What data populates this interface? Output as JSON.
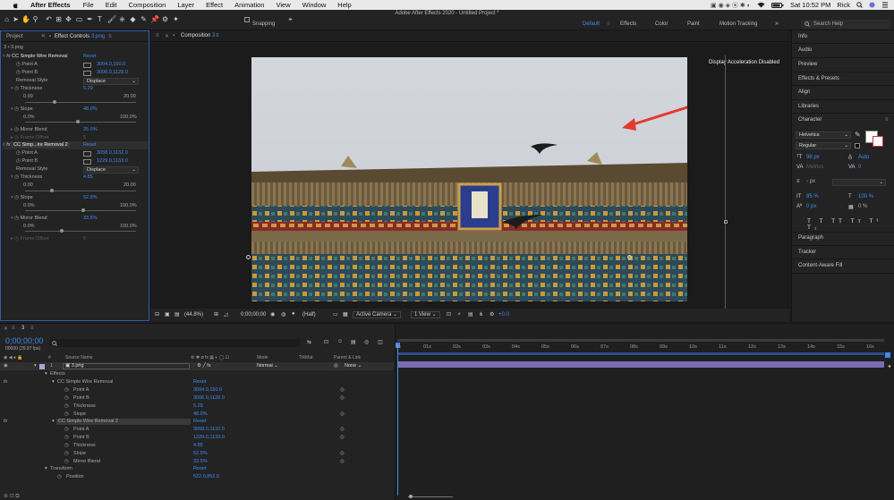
{
  "menubar": {
    "app_name": "After Effects",
    "items": [
      "File",
      "Edit",
      "Composition",
      "Layer",
      "Effect",
      "Animation",
      "View",
      "Window",
      "Help"
    ],
    "clock": "Sat 10:52 PM",
    "user": "Rick"
  },
  "toolbar": {
    "app_title": "Adobe After Effects 2020 - Untitled Project *",
    "snapping_label": "Snapping",
    "workspaces": [
      "Default",
      "Effects",
      "Color",
      "Paint",
      "Motion Tracking"
    ],
    "search_placeholder": "Search Help",
    "accent": "#3e8cf0"
  },
  "left_panel": {
    "tab_project": "Project",
    "tab_effect_controls": "Effect Controls",
    "tab_effect_controls_file": "3.png",
    "breadcrumb": "3 • 3.png",
    "fx1": {
      "name": "CC Simple Wire Removal",
      "reset": "Reset",
      "point_a_label": "Point A",
      "point_a": "3004.0,150.0",
      "point_b_label": "Point B",
      "point_b": "3006.0,1128.0",
      "removal_style_label": "Removal Style",
      "removal_style": "Displace",
      "thickness_label": "Thickness",
      "thickness": "5.29",
      "thickness_min": "0.00",
      "thickness_max": "20.00",
      "slope_label": "Slope",
      "slope": "48.0%",
      "slope_min": "0.0%",
      "slope_max": "100.0%",
      "mirror_blend_label": "Mirror Blend",
      "mirror_blend": "25.0%",
      "frame_offset_label": "Frame Offset",
      "frame_offset": "5"
    },
    "fx2": {
      "name": "CC Simp...ire Removal 2",
      "reset": "Reset",
      "point_a_label": "Point A",
      "point_a": "3058.0,1132.0",
      "point_b_label": "Point B",
      "point_b": "1229.0,1133.0",
      "removal_style_label": "Removal Style",
      "removal_style": "Displace",
      "thickness_label": "Thickness",
      "thickness": "4.85",
      "thickness_min": "0.00",
      "thickness_max": "20.00",
      "slope_label": "Slope",
      "slope": "52.9%",
      "slope_min": "0.0%",
      "slope_max": "100.0%",
      "mirror_blend_label": "Mirror Blend",
      "mirror_blend": "33.5%",
      "mirror_min": "0.0%",
      "mirror_max": "100.0%",
      "frame_offset_label": "Frame Offset",
      "frame_offset": "5"
    }
  },
  "composition": {
    "tab_label": "Composition",
    "tab_name": "3",
    "breadcrumb": "3",
    "overlay_text": "Display Acceleration Disabled",
    "controls": {
      "zoom": "(44.8%)",
      "timecode": "0;00;00;00",
      "resolution": "(Half)",
      "camera": "Active Camera",
      "views": "1 View",
      "exposure": "+0.0"
    }
  },
  "right_panel": {
    "items_top": [
      "Info",
      "Audio",
      "Preview",
      "Effects & Presets",
      "Align",
      "Libraries"
    ],
    "character_title": "Character",
    "font_family": "Helvetica",
    "font_style": "Regular",
    "font_size": "96 px",
    "leading": "Auto",
    "kerning_label": "Metrics",
    "tracking": "0",
    "stroke_width": "- px",
    "vert_scale": "85 %",
    "horiz_scale": "100 %",
    "baseline": "0 px",
    "tsume": "0 %",
    "items_bottom": [
      "Paragraph",
      "Tracker",
      "Content-Aware Fill"
    ]
  },
  "timeline": {
    "tab_label": "3",
    "timecode": "0;00;00;00",
    "fps": "00000 (29.97 fps)",
    "columns": {
      "source_name": "Source Name",
      "mode": "Mode",
      "trkmat": "TrkMat",
      "parent": "Parent & Link"
    },
    "layer": {
      "number": "1",
      "name": "3.png",
      "mode": "Normal",
      "parent": "None"
    },
    "effects_label": "Effects",
    "fx1": {
      "name": "CC Simple Wire Removal",
      "reset": "Reset",
      "props": [
        {
          "label": "Point A",
          "value": "3004.0,150.0"
        },
        {
          "label": "Point B",
          "value": "3006.0,1128.0"
        },
        {
          "label": "Thickness",
          "value": "5.29"
        },
        {
          "label": "Slope",
          "value": "48.0%"
        }
      ]
    },
    "fx2": {
      "name": "CC Simple Wire Removal 2",
      "reset": "Reset",
      "props": [
        {
          "label": "Point A",
          "value": "3058.0,1132.0"
        },
        {
          "label": "Point B",
          "value": "1229.0,1133.0"
        },
        {
          "label": "Thickness",
          "value": "4.85"
        },
        {
          "label": "Slope",
          "value": "52.9%"
        },
        {
          "label": "Mirror Blend",
          "value": "33.5%"
        }
      ]
    },
    "transform_label": "Transform",
    "transform_reset": "Reset",
    "position_label": "Position",
    "position_value": "522.0,852.0",
    "ruler": [
      "0s",
      "01s",
      "02s",
      "03s",
      "04s",
      "05s",
      "06s",
      "07s",
      "08s",
      "09s",
      "10s",
      "11s",
      "12s",
      "13s",
      "14s",
      "15s",
      "16s"
    ]
  }
}
